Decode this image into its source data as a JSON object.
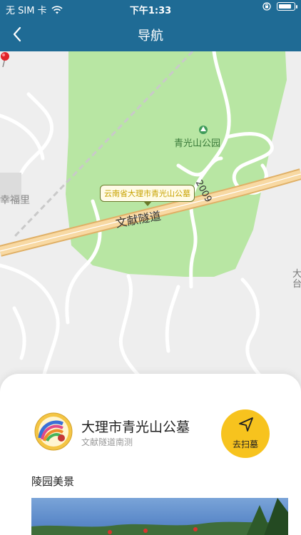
{
  "status_bar": {
    "carrier": "无 SIM 卡",
    "time": "下午1:33",
    "battery_level": 0.92
  },
  "nav": {
    "title": "导航"
  },
  "map": {
    "park_label": "青光山公园",
    "tunnel_label": "文献隧道",
    "road_number": "2009",
    "left_place": "幸福里",
    "right_place": "大台",
    "callout": "云南省大理市青光山公墓"
  },
  "place": {
    "name": "大理市青光山公墓",
    "subtitle": "文献隧道南测",
    "go_label": "去扫墓"
  },
  "section": {
    "title": "陵园美景"
  },
  "colors": {
    "nav_bg": "#1f6b95",
    "park_green": "#b5e5a0",
    "go_button": "#f7c31e",
    "highway": "#f3c98b"
  }
}
